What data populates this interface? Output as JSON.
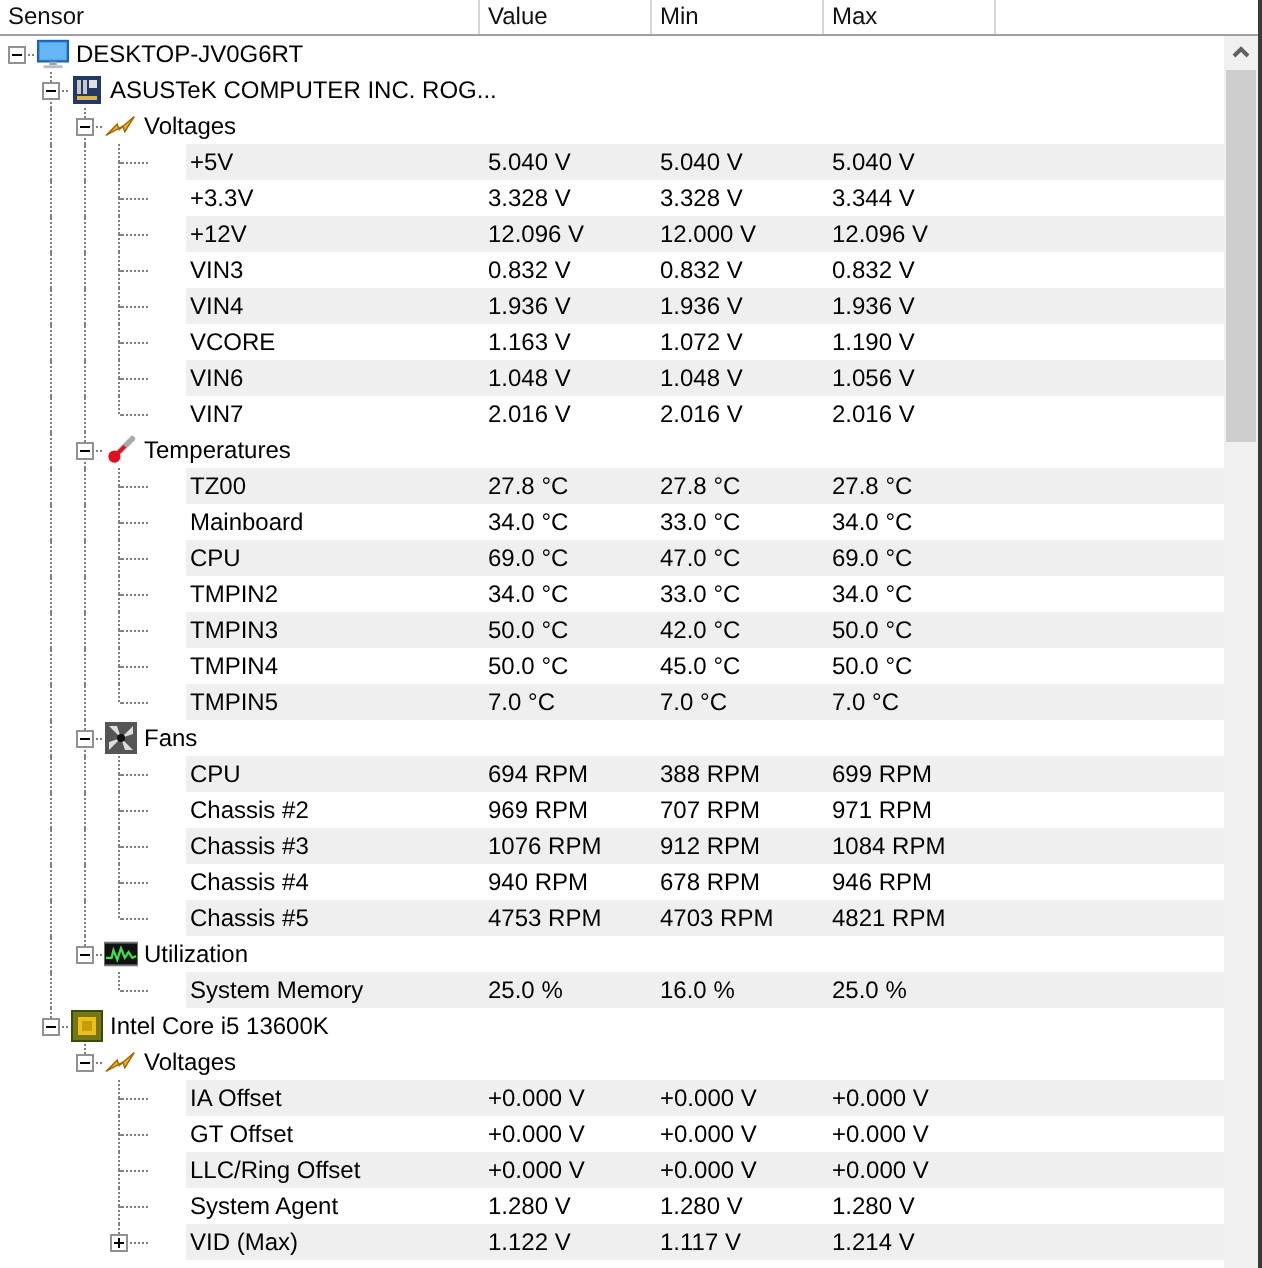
{
  "columns": [
    "Sensor",
    "Value",
    "Min",
    "Max"
  ],
  "tree": {
    "label": "DESKTOP-JV0G6RT",
    "kind": "computer",
    "expanded": true,
    "children": [
      {
        "label": "ASUSTeK COMPUTER INC. ROG...",
        "kind": "board",
        "expanded": true,
        "children": [
          {
            "label": "Voltages",
            "kind": "voltages",
            "expanded": true,
            "children": [
              {
                "label": "+5V",
                "kind": "value",
                "value": "5.040 V",
                "min": "5.040 V",
                "max": "5.040 V"
              },
              {
                "label": "+3.3V",
                "kind": "value",
                "value": "3.328 V",
                "min": "3.328 V",
                "max": "3.344 V"
              },
              {
                "label": "+12V",
                "kind": "value",
                "value": "12.096 V",
                "min": "12.000 V",
                "max": "12.096 V"
              },
              {
                "label": "VIN3",
                "kind": "value",
                "value": "0.832 V",
                "min": "0.832 V",
                "max": "0.832 V"
              },
              {
                "label": "VIN4",
                "kind": "value",
                "value": "1.936 V",
                "min": "1.936 V",
                "max": "1.936 V"
              },
              {
                "label": "VCORE",
                "kind": "value",
                "value": "1.163 V",
                "min": "1.072 V",
                "max": "1.190 V"
              },
              {
                "label": "VIN6",
                "kind": "value",
                "value": "1.048 V",
                "min": "1.048 V",
                "max": "1.056 V"
              },
              {
                "label": "VIN7",
                "kind": "value",
                "value": "2.016 V",
                "min": "2.016 V",
                "max": "2.016 V"
              }
            ]
          },
          {
            "label": "Temperatures",
            "kind": "temperatures",
            "expanded": true,
            "children": [
              {
                "label": "TZ00",
                "kind": "value",
                "value": "27.8 °C",
                "min": "27.8 °C",
                "max": "27.8 °C"
              },
              {
                "label": "Mainboard",
                "kind": "value",
                "value": "34.0 °C",
                "min": "33.0 °C",
                "max": "34.0 °C"
              },
              {
                "label": "CPU",
                "kind": "value",
                "value": "69.0 °C",
                "min": "47.0 °C",
                "max": "69.0 °C"
              },
              {
                "label": "TMPIN2",
                "kind": "value",
                "value": "34.0 °C",
                "min": "33.0 °C",
                "max": "34.0 °C"
              },
              {
                "label": "TMPIN3",
                "kind": "value",
                "value": "50.0 °C",
                "min": "42.0 °C",
                "max": "50.0 °C"
              },
              {
                "label": "TMPIN4",
                "kind": "value",
                "value": "50.0 °C",
                "min": "45.0 °C",
                "max": "50.0 °C"
              },
              {
                "label": "TMPIN5",
                "kind": "value",
                "value": "7.0 °C",
                "min": "7.0 °C",
                "max": "7.0 °C"
              }
            ]
          },
          {
            "label": "Fans",
            "kind": "fans",
            "expanded": true,
            "children": [
              {
                "label": "CPU",
                "kind": "value",
                "value": "694 RPM",
                "min": "388 RPM",
                "max": "699 RPM"
              },
              {
                "label": "Chassis #2",
                "kind": "value",
                "value": "969 RPM",
                "min": "707 RPM",
                "max": "971 RPM"
              },
              {
                "label": "Chassis #3",
                "kind": "value",
                "value": "1076 RPM",
                "min": "912 RPM",
                "max": "1084 RPM"
              },
              {
                "label": "Chassis #4",
                "kind": "value",
                "value": "940 RPM",
                "min": "678 RPM",
                "max": "946 RPM"
              },
              {
                "label": "Chassis #5",
                "kind": "value",
                "value": "4753 RPM",
                "min": "4703 RPM",
                "max": "4821 RPM"
              }
            ]
          },
          {
            "label": "Utilization",
            "kind": "utilization",
            "expanded": true,
            "children": [
              {
                "label": "System Memory",
                "kind": "value",
                "value": "25.0 %",
                "min": "16.0 %",
                "max": "25.0 %"
              }
            ]
          }
        ]
      },
      {
        "label": "Intel Core i5 13600K",
        "kind": "cpu",
        "expanded": true,
        "children": [
          {
            "label": "Voltages",
            "kind": "voltages",
            "expanded": true,
            "children": [
              {
                "label": "IA Offset",
                "kind": "value",
                "value": "+0.000 V",
                "min": "+0.000 V",
                "max": "+0.000 V"
              },
              {
                "label": "GT Offset",
                "kind": "value",
                "value": "+0.000 V",
                "min": "+0.000 V",
                "max": "+0.000 V"
              },
              {
                "label": "LLC/Ring Offset",
                "kind": "value",
                "value": "+0.000 V",
                "min": "+0.000 V",
                "max": "+0.000 V"
              },
              {
                "label": "System Agent",
                "kind": "value",
                "value": "1.280 V",
                "min": "1.280 V",
                "max": "1.280 V"
              },
              {
                "label": "VID (Max)",
                "kind": "collapsed",
                "value": "1.122 V",
                "min": "1.117 V",
                "max": "1.214 V"
              }
            ]
          }
        ]
      }
    ]
  }
}
